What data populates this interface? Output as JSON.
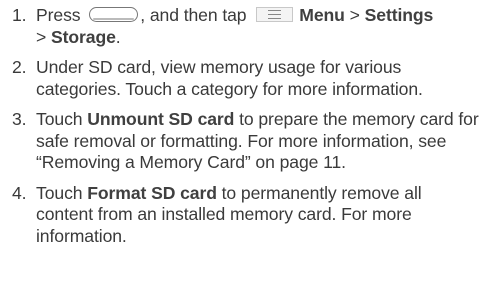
{
  "steps": [
    {
      "num": "1.",
      "press": "Press",
      "then_tap": ", and then tap",
      "menu": "Menu",
      "gt1": ">",
      "settings": "Settings",
      "gt2": ">",
      "storage": "Storage",
      "end": ".",
      "icons": [
        "home-key",
        "menu-key"
      ]
    },
    {
      "num": "2.",
      "text": "Under SD card, view memory usage for various categories. Touch a category for more information."
    },
    {
      "num": "3.",
      "touch": "Touch",
      "bold": "Unmount SD card",
      "rest": " to prepare the memory card for safe removal or formatting. For more information, see “Removing a Memory Card” on page 11."
    },
    {
      "num": "4.",
      "touch": "Touch",
      "bold": "Format SD card",
      "rest": " to permanently remove all content from an installed memory card. For more information."
    }
  ]
}
